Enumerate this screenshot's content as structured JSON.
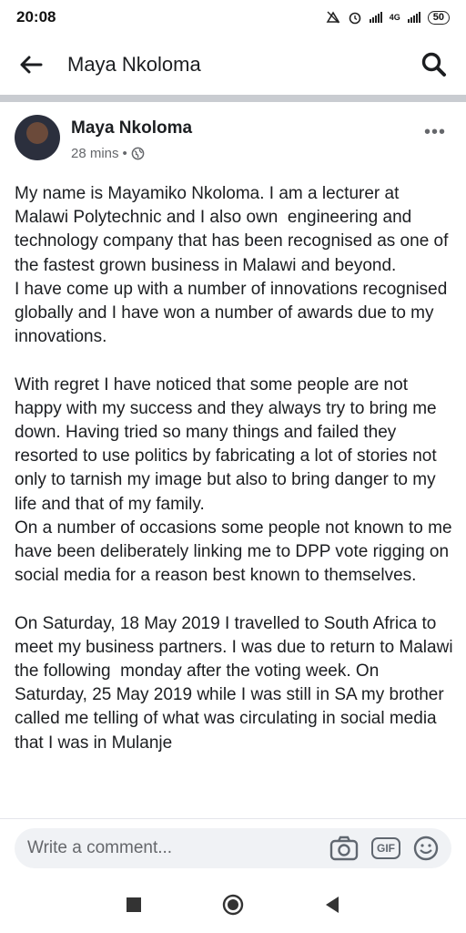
{
  "status_bar": {
    "time": "20:08",
    "network": "4G",
    "battery": "50"
  },
  "header": {
    "title": "Maya Nkoloma"
  },
  "post": {
    "author": "Maya Nkoloma",
    "time": "28 mins",
    "separator": "•",
    "body": "My name is Mayamiko Nkoloma. I am a lecturer at Malawi Polytechnic and I also own  engineering and technology company that has been recognised as one of the fastest grown business in Malawi and beyond.\nI have come up with a number of innovations recognised globally and I have won a number of awards due to my innovations.\n\nWith regret I have noticed that some people are not happy with my success and they always try to bring me down. Having tried so many things and failed they resorted to use politics by fabricating a lot of stories not only to tarnish my image but also to bring danger to my life and that of my family.\nOn a number of occasions some people not known to me have been deliberately linking me to DPP vote rigging on social media for a reason best known to themselves.\n\nOn Saturday, 18 May 2019 I travelled to South Africa to meet my business partners. I was due to return to Malawi the following  monday after the voting week. On Saturday, 25 May 2019 while I was still in SA my brother called me telling of what was circulating in social media that I was in Mulanje"
  },
  "comment": {
    "placeholder": "Write a comment...",
    "gif_label": "GIF"
  },
  "colors": {
    "divider": "#c9ccd1",
    "text": "#1c1e21",
    "muted": "#65676b",
    "input_bg": "#f0f2f5"
  }
}
